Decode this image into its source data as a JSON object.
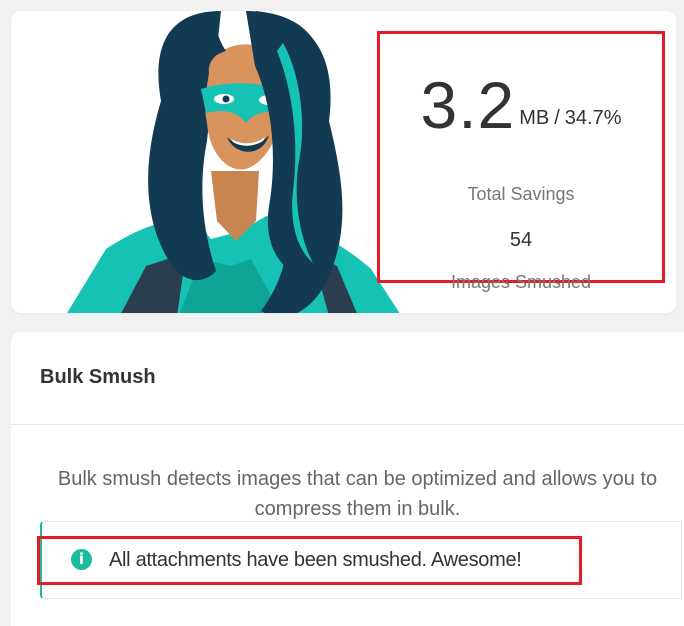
{
  "stats": {
    "savings_size": "3.2",
    "savings_unit": "MB",
    "separator": "/",
    "savings_percent": "34.7%",
    "savings_label": "Total Savings",
    "images_count": "54",
    "images_label": "Images Smushed"
  },
  "bulk": {
    "title": "Bulk Smush",
    "description": "Bulk smush detects images that can be optimized and allows you to compress them in bulk.",
    "notice": {
      "icon": "info-icon",
      "icon_glyph": "i",
      "text": "All attachments have been smushed. Awesome!"
    }
  },
  "colors": {
    "accent": "#1abc9c",
    "highlight": "#e51c23",
    "hair": "#123a53",
    "suit_teal": "#16c2b3",
    "skin": "#d9935d"
  }
}
